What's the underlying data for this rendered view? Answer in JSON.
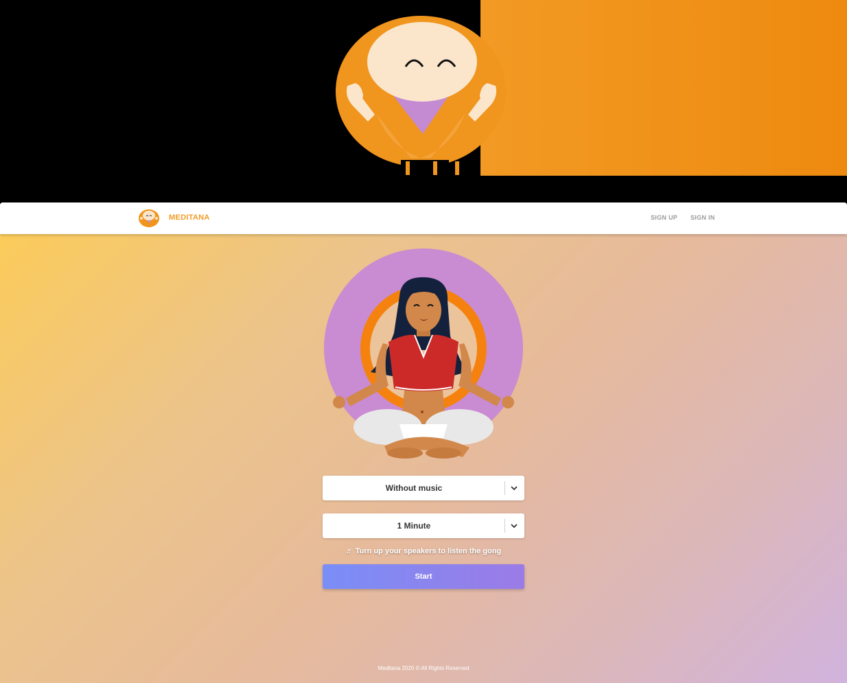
{
  "brand": {
    "name": "MEDITANA",
    "color": "#f29a24"
  },
  "nav": {
    "sign_up": "SIGN UP",
    "sign_in": "SIGN IN"
  },
  "form": {
    "music_select": {
      "value": "Without music"
    },
    "duration_select": {
      "value": "1 Minute"
    },
    "hint": "♬ Turn up your speakers to listen the gong",
    "start_label": "Start"
  },
  "footer": {
    "text": "Meditana 2020 © All Rights Reserved"
  },
  "icons": {
    "hero": "meditating-monk-logo",
    "nav": "meditating-monk-logo-small",
    "select_arrow": "chevron-down-icon"
  },
  "colors": {
    "accent": "#f29a24",
    "halo_purple": "#c98bd2",
    "button_start": "#7a8ef7",
    "button_end": "#9b7be6"
  }
}
